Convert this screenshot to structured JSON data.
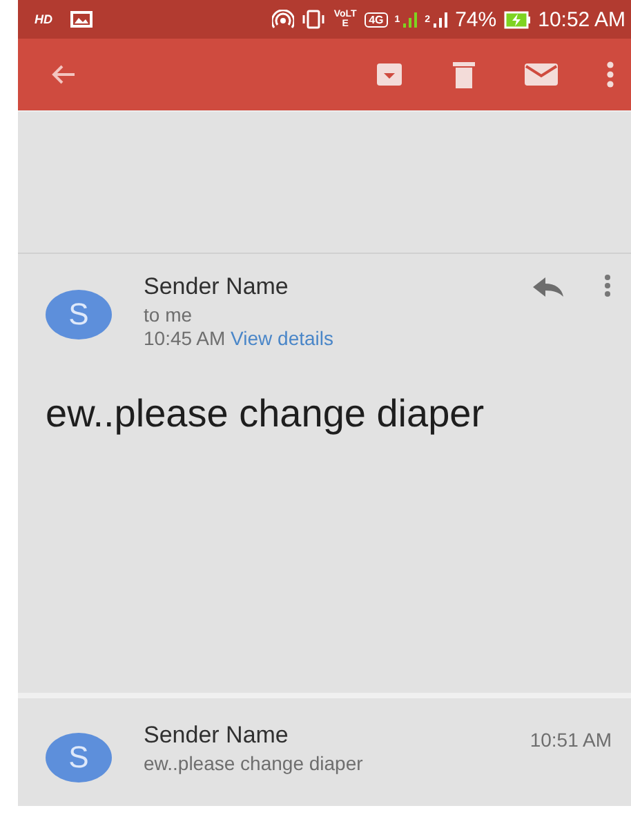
{
  "status_bar": {
    "hd": "HD",
    "volte": "VoLTE",
    "network": "4G",
    "sim_1": "1",
    "sim_2": "2",
    "battery": "74%",
    "time": "10:52 AM"
  },
  "messages": [
    {
      "kind": "expanded",
      "avatar": "S",
      "sender": "Sender Name",
      "recipient": "to me",
      "time": "10:45 AM",
      "link": "View details",
      "body": "ew..please change diaper"
    },
    {
      "kind": "collapsed",
      "avatar": "S",
      "sender": "Sender Name",
      "snippet": "ew..please change diaper",
      "time": "10:51 AM"
    }
  ]
}
